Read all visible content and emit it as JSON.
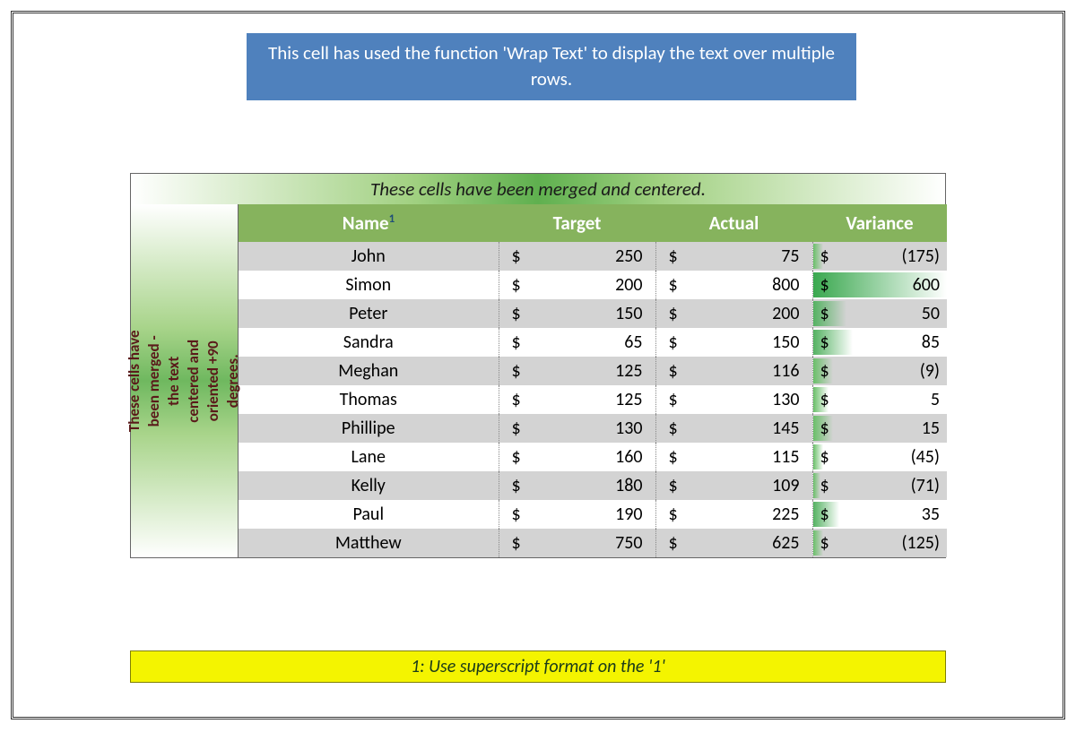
{
  "wrap_text_box": "This cell has used the function 'Wrap Text' to display the text over multiple rows.",
  "merge_title": "These cells have been merged and centered.",
  "vertical_cell": "These cells have been merged - the text centered and oriented +90 degrees.",
  "headers": {
    "name": "Name",
    "name_sup": "1",
    "target": "Target",
    "actual": "Actual",
    "variance": "Variance"
  },
  "currency": "$",
  "rows": [
    {
      "name": "John",
      "target": "250",
      "actual": "75",
      "variance": "(175)",
      "bar_pct": 8,
      "bar_color": "#6abf69"
    },
    {
      "name": "Simon",
      "target": "200",
      "actual": "800",
      "variance": "600",
      "bar_pct": 100,
      "bar_color": "#3aa84f"
    },
    {
      "name": "Peter",
      "target": "150",
      "actual": "200",
      "variance": "50",
      "bar_pct": 25,
      "bar_color": "#55b262"
    },
    {
      "name": "Sandra",
      "target": "65",
      "actual": "150",
      "variance": "85",
      "bar_pct": 30,
      "bar_color": "#55b262"
    },
    {
      "name": "Meghan",
      "target": "125",
      "actual": "116",
      "variance": "(9)",
      "bar_pct": 15,
      "bar_color": "#6abf69"
    },
    {
      "name": "Thomas",
      "target": "125",
      "actual": "130",
      "variance": "5",
      "bar_pct": 12,
      "bar_color": "#6abf69"
    },
    {
      "name": "Phillipe",
      "target": "130",
      "actual": "145",
      "variance": "15",
      "bar_pct": 15,
      "bar_color": "#6abf69"
    },
    {
      "name": "Lane",
      "target": "160",
      "actual": "115",
      "variance": "(45)",
      "bar_pct": 8,
      "bar_color": "#6abf69"
    },
    {
      "name": "Kelly",
      "target": "180",
      "actual": "109",
      "variance": "(71)",
      "bar_pct": 6,
      "bar_color": "#6abf69"
    },
    {
      "name": "Paul",
      "target": "190",
      "actual": "225",
      "variance": "35",
      "bar_pct": 20,
      "bar_color": "#55b262"
    },
    {
      "name": "Matthew",
      "target": "750",
      "actual": "625",
      "variance": "(125)",
      "bar_pct": 8,
      "bar_color": "#6abf69"
    }
  ],
  "footnote": "1: Use superscript format on the '1'",
  "chart_data": {
    "type": "table",
    "columns": [
      "Name",
      "Target",
      "Actual",
      "Variance"
    ],
    "rows": [
      [
        "John",
        250,
        75,
        -175
      ],
      [
        "Simon",
        200,
        800,
        600
      ],
      [
        "Peter",
        150,
        200,
        50
      ],
      [
        "Sandra",
        65,
        150,
        85
      ],
      [
        "Meghan",
        125,
        116,
        -9
      ],
      [
        "Thomas",
        125,
        130,
        5
      ],
      [
        "Phillipe",
        130,
        145,
        15
      ],
      [
        "Lane",
        160,
        115,
        -45
      ],
      [
        "Kelly",
        180,
        109,
        -71
      ],
      [
        "Paul",
        190,
        225,
        35
      ],
      [
        "Matthew",
        750,
        625,
        -125
      ]
    ],
    "currency": "USD",
    "title": "These cells have been merged and centered."
  }
}
